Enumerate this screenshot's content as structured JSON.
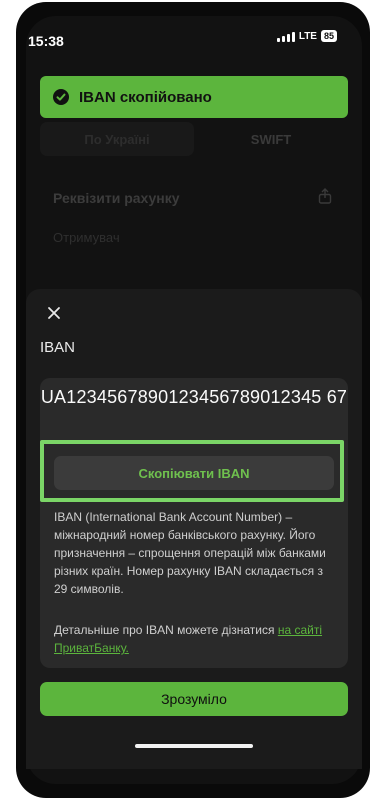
{
  "status_bar": {
    "time": "15:38",
    "network": "LTE",
    "battery": "85"
  },
  "toast": {
    "text": "IBAN скопійовано"
  },
  "background": {
    "tabs": [
      "По Україні",
      "SWIFT"
    ],
    "heading": "Реквізити рахунку",
    "recipient_label": "Отримувач"
  },
  "sheet": {
    "title": "IBAN",
    "iban": "UA1234567890123456789012345 67",
    "copy_button": "Скопіювати IBAN",
    "description": "IBAN (International Bank Account Number) – міжнародний номер банківського рахунку. Його призначення – спрощення операцій між банками різних країн. Номер рахунку IBAN складається з 29 символів.",
    "more_text": "Детальніше про IBAN можете дізнатися ",
    "more_link": "на сайті ПриватБанку.",
    "ok_button": "Зрозуміло"
  },
  "colors": {
    "accent": "#5cb53d",
    "highlight": "#7bd567",
    "background": "#121212"
  },
  "icons": [
    "check-circle-icon",
    "signal-icon",
    "share-icon",
    "close-icon"
  ]
}
